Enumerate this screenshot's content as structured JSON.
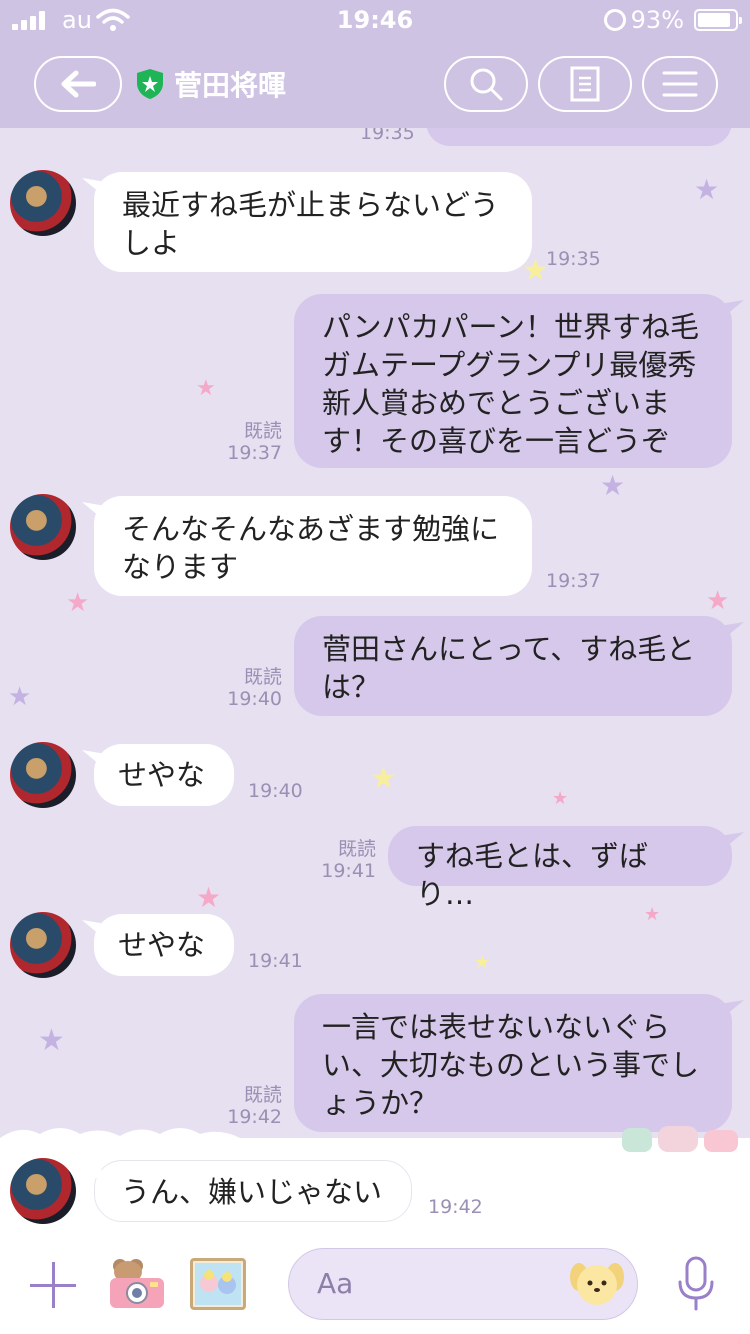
{
  "status_bar": {
    "carrier": "au",
    "time": "19:46",
    "battery": "93%"
  },
  "header": {
    "title": "菅田将暉"
  },
  "messages": [
    {
      "side": "left",
      "text": "最近すね毛が止まらないどう\nしよ",
      "time": "19:35"
    },
    {
      "side": "right",
      "text": "パンパカパーン！世界すね毛\nガムテープグランプリ最優秀\n新人賞おめでとうございま\nす！その喜びを一言どうぞ",
      "read": "既読",
      "time": "19:37"
    },
    {
      "side": "left",
      "text": "そんなそんなあざます勉強に\nなります",
      "time": "19:37"
    },
    {
      "side": "right",
      "text": "菅田さんにとって、すね毛と\nは？",
      "read": "既読",
      "time": "19:40"
    },
    {
      "side": "left",
      "text": "せやな",
      "time": "19:40"
    },
    {
      "side": "right",
      "text": "すね毛とは、ずばり…",
      "read": "既読",
      "time": "19:41"
    },
    {
      "side": "left",
      "text": "せやな",
      "time": "19:41"
    },
    {
      "side": "right",
      "text": "一言では表せないないぐら\nい、大切なものという事でし\nょうか？",
      "read": "既読",
      "time": "19:42"
    },
    {
      "side": "left",
      "text": "うん、嫌いじゃない",
      "time": "19:42"
    }
  ],
  "partial_top": {
    "time": "19:35"
  },
  "input": {
    "placeholder": "Aa"
  },
  "colors": {
    "header": "#cfc3e3",
    "chat_bg": "#e6e0f1",
    "sent_bubble": "#d6c8ea",
    "received_bubble": "#ffffff",
    "accent": "#9a7fc9"
  }
}
